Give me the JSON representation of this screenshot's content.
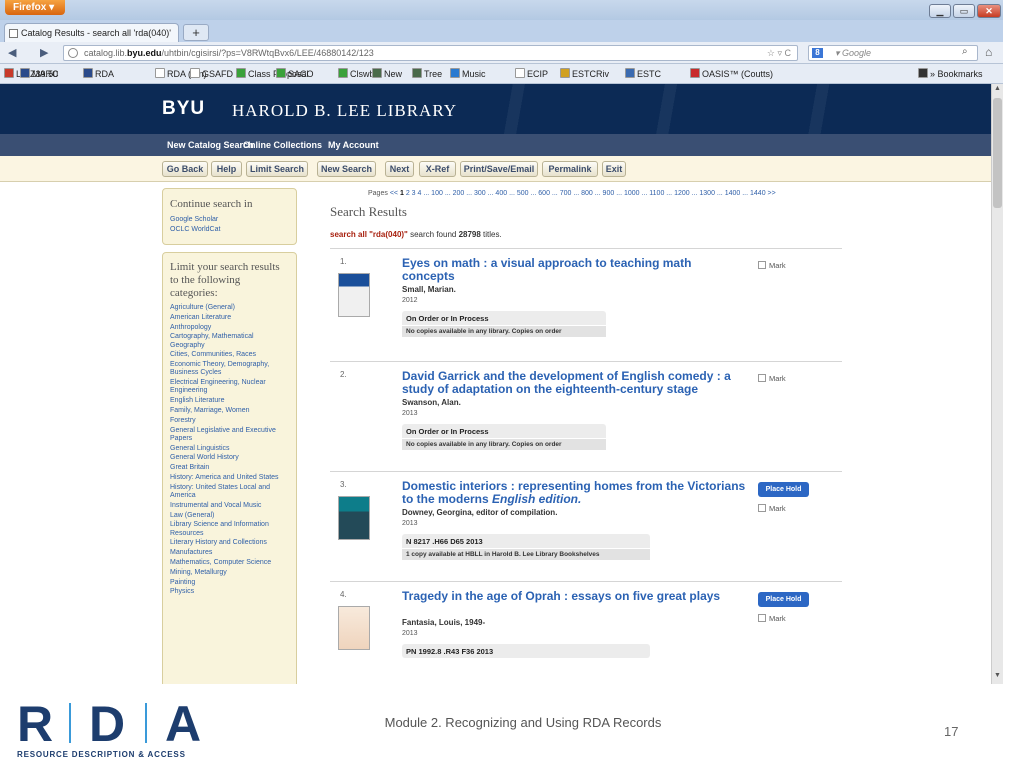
{
  "browser": {
    "app_button": "Firefox ▾",
    "tab_title": "Catalog Results - search all 'rda(040)'",
    "new_tab": "+",
    "url_prefix": "catalog.lib.",
    "url_domain": "byu.edu",
    "url_rest": "/uhtbin/cgisirsi/?ps=V8RWtqBvx6/LEE/46880142/123",
    "url_right": "☆ ▿ C",
    "search_engine": "8",
    "search_placeholder": "▾ Google",
    "bookmarks": [
      {
        "label": "LC Z39.50",
        "color": "#c83a2a"
      },
      {
        "label": "MARC",
        "color": "#2a4a8a"
      },
      {
        "label": "RDA",
        "color": "#2a4a8a"
      },
      {
        "label": "RDA (rlm)",
        "color": "#ffffff"
      },
      {
        "label": "GSAFD",
        "color": "#ffffff"
      },
      {
        "label": "Class Proposal",
        "color": "#3aa13a"
      },
      {
        "label": "SACO",
        "color": "#3aa13a"
      },
      {
        "label": "Clswb",
        "color": "#3aa13a"
      },
      {
        "label": "New",
        "color": "#4a6a4a"
      },
      {
        "label": "Tree",
        "color": "#4a6a4a"
      },
      {
        "label": "Music",
        "color": "#2a7ad0"
      },
      {
        "label": "ECIP",
        "color": "#ffffff"
      },
      {
        "label": "ESTCRiv",
        "color": "#d0a020"
      },
      {
        "label": "ESTC",
        "color": "#3a6ab0"
      },
      {
        "label": "OASIS™ (Coutts)",
        "color": "#c82a2a"
      },
      {
        "label": "» Bookmarks",
        "color": "#333333"
      }
    ]
  },
  "site": {
    "logo": "BYU",
    "library": "HAROLD B. LEE LIBRARY",
    "nav": [
      "New Catalog Search",
      "Online Collections",
      "My Account"
    ],
    "toolbar": [
      "Go Back",
      "Help",
      "Limit Search",
      "New Search",
      "Next",
      "X-Ref",
      "Print/Save/Email",
      "Permalink",
      "Exit"
    ]
  },
  "sidebar": {
    "continue_title": "Continue search in",
    "continue_links": [
      "Google Scholar",
      "OCLC WorldCat"
    ],
    "limit_title": "Limit your search results to the following categories:",
    "categories": [
      "Agriculture (General)",
      "American Literature",
      "Anthropology",
      "Cartography, Mathematical Geography",
      "Cities, Communities, Races",
      "Economic Theory, Demography, Business Cycles",
      "Electrical Engineering, Nuclear Engineering",
      "English Literature",
      "Family, Marriage, Women",
      "Forestry",
      "General Legislative and Executive Papers",
      "General Linguistics",
      "General World History",
      "Great Britain",
      "History: America and United States",
      "History: United States Local and America",
      "Instrumental and Vocal Music",
      "Law (General)",
      "Library Science and Information Resources",
      "Literary History and Collections",
      "Manufactures",
      "Mathematics, Computer Science",
      "Mining, Metallurgy",
      "Painting",
      "Physics"
    ]
  },
  "results": {
    "pages_label": "Pages",
    "pages": [
      "<<",
      "1",
      "2",
      "3",
      "4",
      "... 100",
      "... 200",
      "... 300",
      "... 400",
      "... 500",
      "... 600",
      "... 700",
      "... 800",
      "... 900",
      "... 1000",
      "... 1100",
      "... 1200",
      "... 1300",
      "... 1400",
      "... 1440",
      ">>"
    ],
    "heading": "Search Results",
    "query": "search all \"rda(040)\"",
    "found_text": " search found ",
    "count": "28798",
    "titles_word": " titles.",
    "mark_label": "Mark",
    "place_hold_label": "Place Hold",
    "records": [
      {
        "num": "1.",
        "title": "Eyes on math : a visual approach to teaching math concepts",
        "edition": "",
        "author": "Small, Marian.",
        "year": "2012",
        "status1": "On Order or In Process",
        "status2": "No copies available in any library. Copies on order",
        "hold": false
      },
      {
        "num": "2.",
        "title": "David Garrick and the development of English comedy : a study of adaptation on the eighteenth-century stage",
        "edition": "",
        "author": "Swanson, Alan.",
        "year": "2013",
        "status1": "On Order or In Process",
        "status2": "No copies available in any library. Copies on order",
        "hold": false
      },
      {
        "num": "3.",
        "title": "Domestic interiors : representing homes from the Victorians to the moderns ",
        "edition": "English edition.",
        "author": "Downey, Georgina, editor of compilation.",
        "year": "2013",
        "status1": "N 8217 .H66 D65 2013",
        "status2": "1 copy available at HBLL in Harold B. Lee Library Bookshelves",
        "hold": true
      },
      {
        "num": "4.",
        "title": "Tragedy in the age of Oprah : essays on five great plays",
        "edition": "",
        "author": "Fantasia, Louis, 1949-",
        "year": "2013",
        "status1": "PN 1992.8 .R43 F36 2013",
        "status2": "",
        "hold": true
      }
    ]
  },
  "footer": {
    "logo_letters": [
      "R",
      "D",
      "A"
    ],
    "tagline": "RESOURCE DESCRIPTION & ACCESS",
    "module": "Module 2. Recognizing and Using RDA Records",
    "slide_number": "17"
  }
}
